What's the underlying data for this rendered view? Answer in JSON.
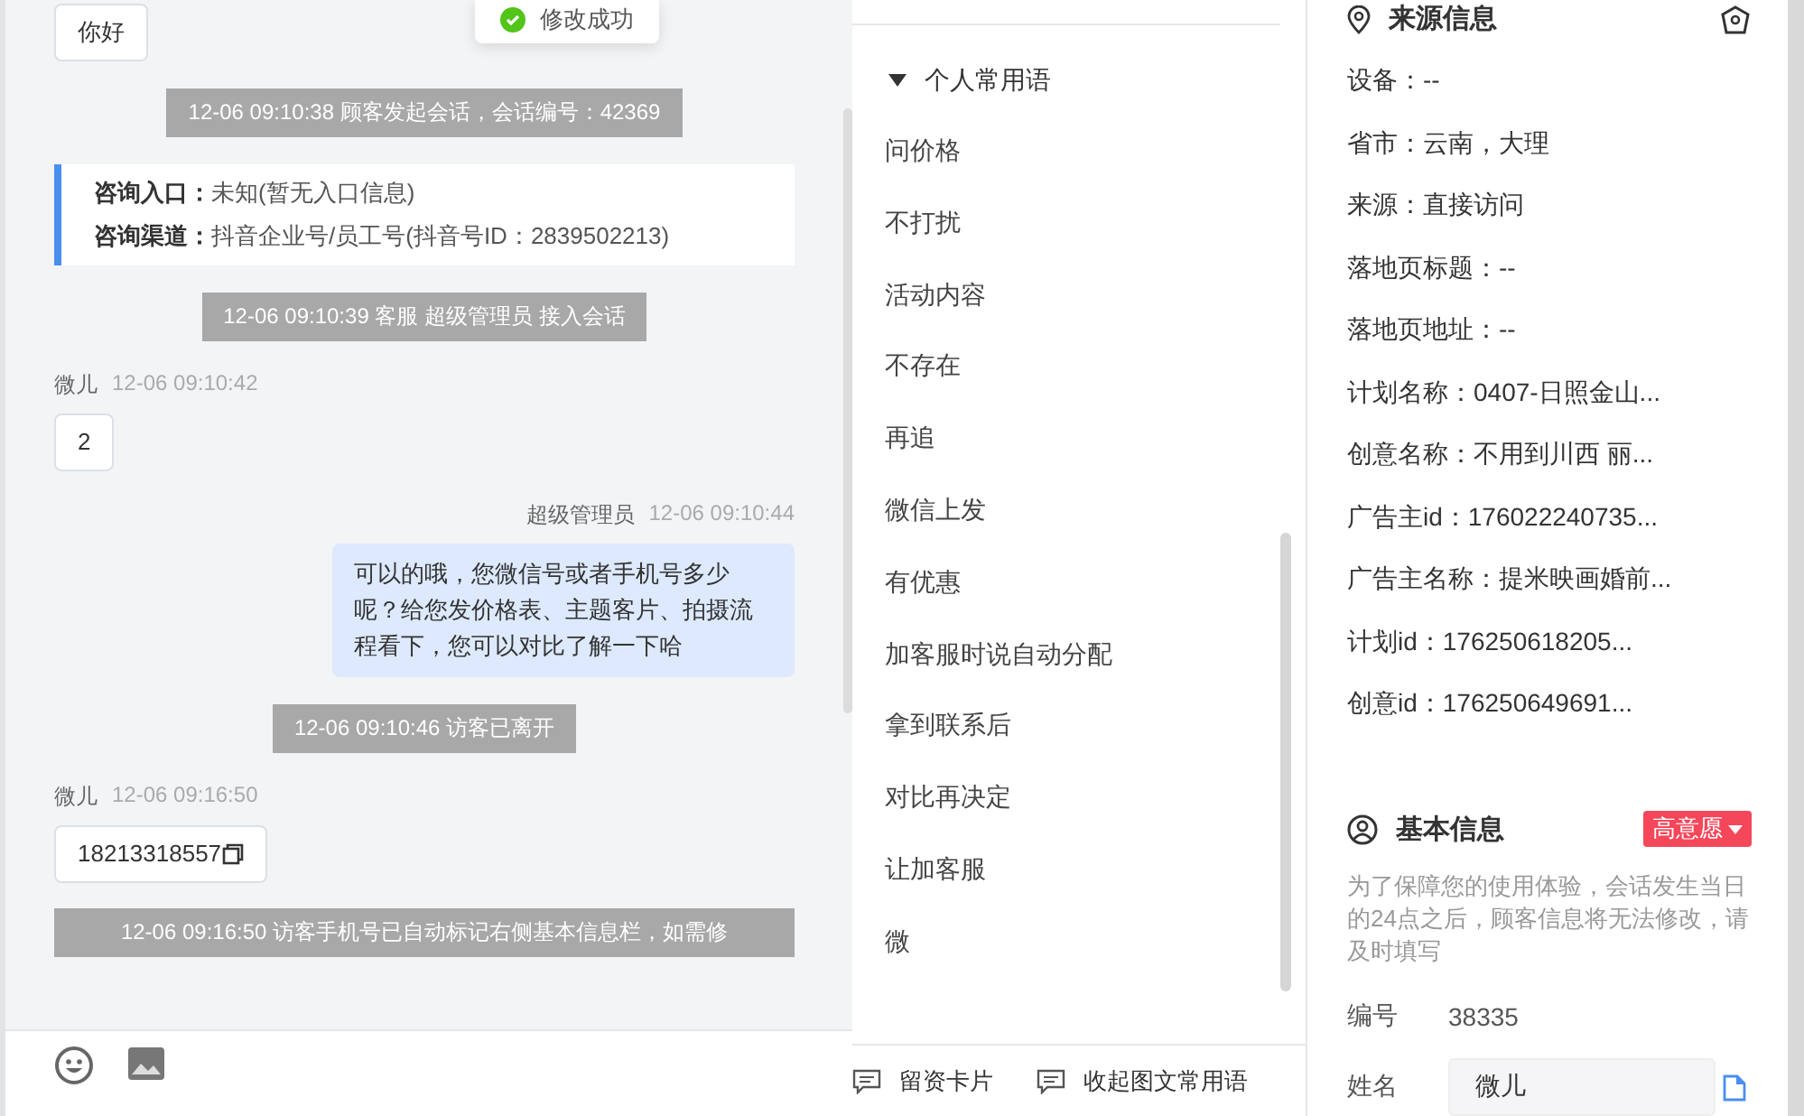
{
  "toast": {
    "text": "修改成功"
  },
  "chat": {
    "messages": [
      {
        "kind": "visitor",
        "text": "你好"
      },
      {
        "kind": "system",
        "text": "12-06 09:10:38 顾客发起会话，会话编号：42369"
      },
      {
        "kind": "entry",
        "lines": [
          {
            "label": "咨询入口：",
            "value": "未知(暂无入口信息)"
          },
          {
            "label": "咨询渠道：",
            "value": "抖音企业号/员工号(抖音号ID：2839502213)"
          }
        ]
      },
      {
        "kind": "system",
        "text": "12-06 09:10:39 客服 超级管理员 接入会话"
      },
      {
        "kind": "visitor",
        "sender": "微儿",
        "time": "12-06 09:10:42",
        "text": "2"
      },
      {
        "kind": "agent",
        "sender": "超级管理员",
        "time": "12-06 09:10:44",
        "text": "可以的哦，您微信号或者手机号多少呢？给您发价格表、主题客片、拍摄流程看下，您可以对比了解一下哈"
      },
      {
        "kind": "system",
        "text": "12-06 09:10:46 访客已离开"
      },
      {
        "kind": "visitor",
        "sender": "微儿",
        "time": "12-06 09:16:50",
        "text": "18213318557",
        "copyable": true
      },
      {
        "kind": "system",
        "text": "12-06 09:16:50 访客手机号已自动标记右侧基本信息栏，如需修"
      }
    ]
  },
  "phrases": {
    "group": {
      "title": "个人常用语",
      "expanded": true
    },
    "items": [
      "问价格",
      "不打扰",
      "活动内容",
      "不存在",
      "再追",
      "微信上发",
      "有优惠",
      "加客服时说自动分配",
      "拿到联系后",
      "对比再决定",
      "让加客服",
      "微"
    ],
    "actions": [
      {
        "label": "留资卡片"
      },
      {
        "label": "收起图文常用语"
      }
    ]
  },
  "source_info": {
    "title": "来源信息",
    "fields": [
      "设备：--",
      "省市：云南，大理",
      "来源：直接访问",
      "落地页标题：--",
      "落地页地址：--",
      "计划名称：0407-日照金山...",
      "创意名称：不用到川西 丽...",
      "广告主id：176022240735...",
      "广告主名称：提米映画婚前...",
      "计划id：176250618205...",
      "创意id：176250649691..."
    ]
  },
  "basic_info": {
    "title": "基本信息",
    "intent_tag": "高意愿",
    "note": "为了保障您的使用体验，会话发生当日的24点之后，顾客信息将无法修改，请及时填写",
    "fields": [
      {
        "kind": "text",
        "label": "编号",
        "value": "38335"
      },
      {
        "kind": "input",
        "label": "姓名",
        "value": "微儿"
      }
    ]
  }
}
